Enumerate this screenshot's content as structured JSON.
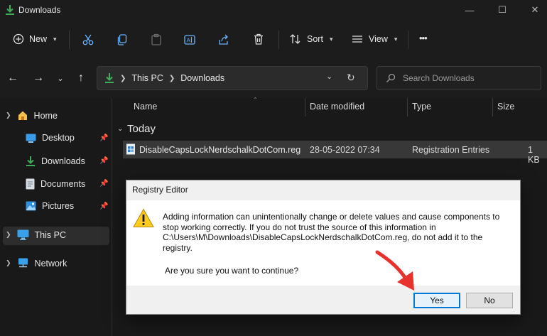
{
  "window": {
    "title": "Downloads",
    "minimize_glyph": "—",
    "maximize_glyph": "☐",
    "close_glyph": "✕"
  },
  "toolbar": {
    "new_label": "New",
    "sort_label": "Sort",
    "view_label": "View",
    "more_glyph": "•••"
  },
  "address": {
    "segments": [
      "This PC",
      "Downloads"
    ],
    "search_placeholder": "Search Downloads"
  },
  "nav_pane": {
    "items": [
      {
        "label": "Home",
        "icon": "home-icon"
      },
      {
        "label": "Desktop",
        "icon": "desktop-icon",
        "pinned": true
      },
      {
        "label": "Downloads",
        "icon": "downloads-icon",
        "pinned": true
      },
      {
        "label": "Documents",
        "icon": "documents-icon",
        "pinned": true
      },
      {
        "label": "Pictures",
        "icon": "pictures-icon",
        "pinned": true
      },
      {
        "label": "This PC",
        "icon": "computer-icon",
        "selected": true
      },
      {
        "label": "Network",
        "icon": "network-icon"
      }
    ]
  },
  "file_list": {
    "columns": [
      "Name",
      "Date modified",
      "Type",
      "Size"
    ],
    "group_label": "Today",
    "rows": [
      {
        "name": "DisableCapsLockNerdschalkDotCom.reg",
        "date": "28-05-2022 07:34",
        "type": "Registration Entries",
        "size": "1 KB"
      }
    ]
  },
  "dialog": {
    "title": "Registry Editor",
    "message": "Adding information can unintentionally change or delete values and cause components to stop working correctly. If you do not trust the source of this information in C:\\Users\\M\\Downloads\\DisableCapsLockNerdschalkDotCom.reg, do not add it to the registry.",
    "question": "Are you sure you want to continue?",
    "yes_label": "Yes",
    "no_label": "No"
  },
  "colors": {
    "accent": "#0078d7",
    "annotation_arrow": "#e8322e",
    "download_green": "#3fae5a",
    "folder_yellow": "#f2c14e"
  }
}
